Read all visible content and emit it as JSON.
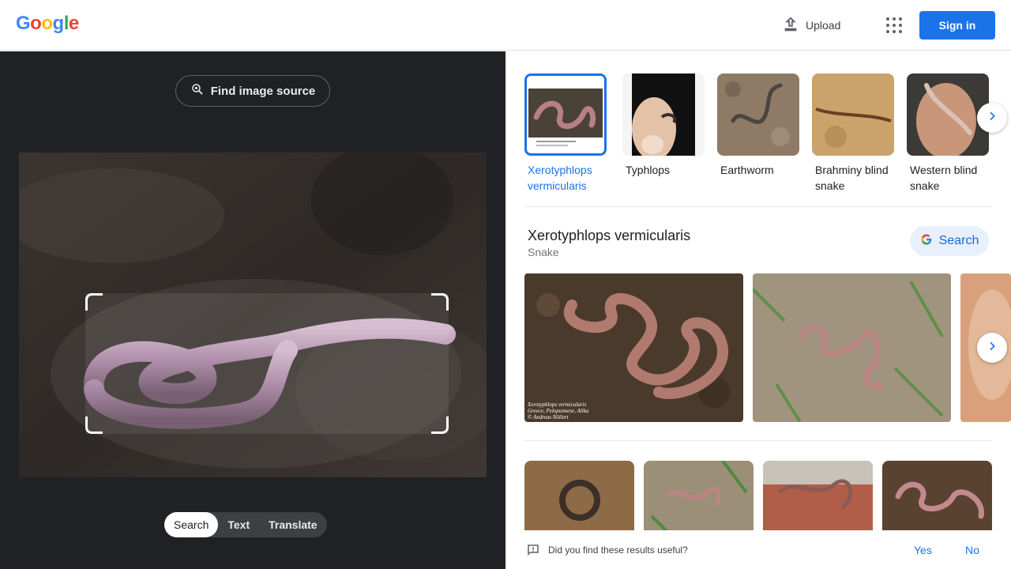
{
  "header": {
    "logo_letters": [
      "G",
      "o",
      "o",
      "g",
      "l",
      "e"
    ],
    "logo_colors": [
      "#4285f4",
      "#ea4335",
      "#fbbc05",
      "#4285f4",
      "#34a853",
      "#ea4335"
    ],
    "upload_label": "Upload",
    "signin_label": "Sign in",
    "apps_icon": "apps-grid-icon"
  },
  "left": {
    "find_source_label": "Find image source",
    "modes": [
      {
        "label": "Search",
        "active": true
      },
      {
        "label": "Text",
        "active": false
      },
      {
        "label": "Translate",
        "active": false
      }
    ]
  },
  "right": {
    "suggestions": [
      {
        "label": "Xerotyphlops vermicularis",
        "selected": true
      },
      {
        "label": "Typhlops",
        "selected": false
      },
      {
        "label": "Earthworm",
        "selected": false
      },
      {
        "label": "Brahminy blind snake",
        "selected": false
      },
      {
        "label": "Western blind snake",
        "selected": false
      }
    ],
    "entity": {
      "title": "Xerotyphlops vermicularis",
      "subtitle": "Snake",
      "search_label": "Search"
    },
    "photo_caption": "Xerotyphlops vermicularis\nGreece, Peloponnese, Alika\n© Andreas Nöllert",
    "feedback": {
      "question": "Did you find these results useful?",
      "yes_label": "Yes",
      "no_label": "No"
    }
  },
  "colors": {
    "accent": "#1a73e8",
    "dark_panel": "#202124"
  }
}
